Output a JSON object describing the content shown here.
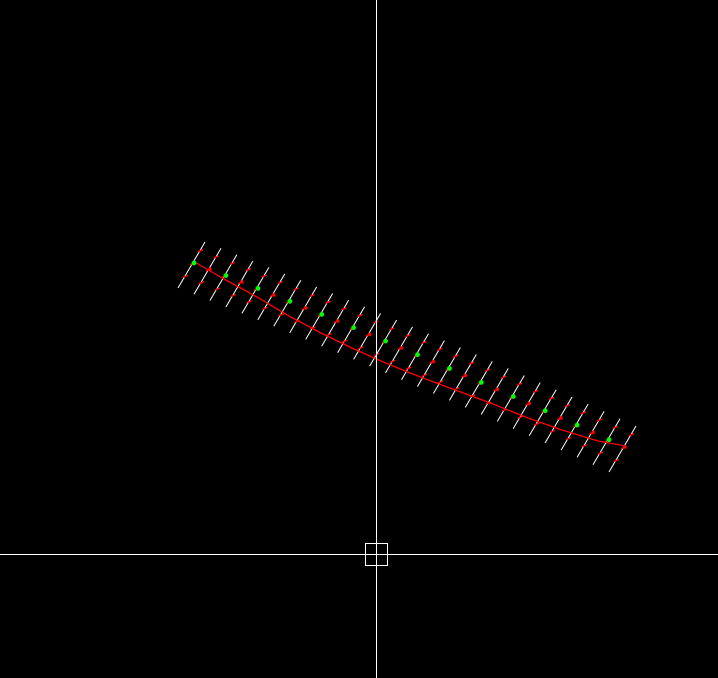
{
  "viewport": {
    "background_color": "#000000"
  },
  "colors": {
    "crosshair": "#ffffff",
    "tick": "#ffffff",
    "curve": "#ff0000",
    "marker_major": "#00ff00",
    "marker_minor": "#ff0000"
  },
  "cursor": {
    "icon": "crosshair-pickbox-icon"
  },
  "ticks": {
    "count": 28
  }
}
